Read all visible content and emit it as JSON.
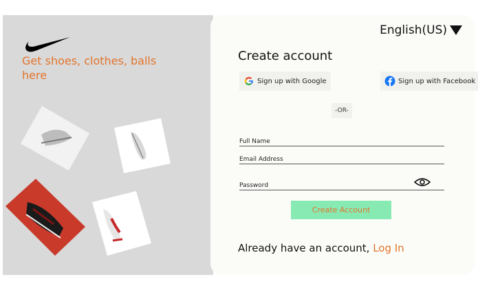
{
  "brand": {
    "tagline": "Get shoes, clothes, balls here",
    "accent_color": "#e2742c"
  },
  "header": {
    "language_label": "English(US)",
    "language_icon": "caret-down-icon"
  },
  "signup": {
    "title": "Create account",
    "google_label": "Sign up with Google",
    "facebook_label": "Sign up with Facebook",
    "divider_label": "-OR-",
    "full_name_label": "Full Name",
    "email_label": "Email Address",
    "password_label": "Password",
    "password_icon": "eye-icon",
    "submit_label": "Create Account",
    "button_color": "#87eab2"
  },
  "footer": {
    "already_text": "Already have an account,",
    "login_label": "Log In"
  }
}
